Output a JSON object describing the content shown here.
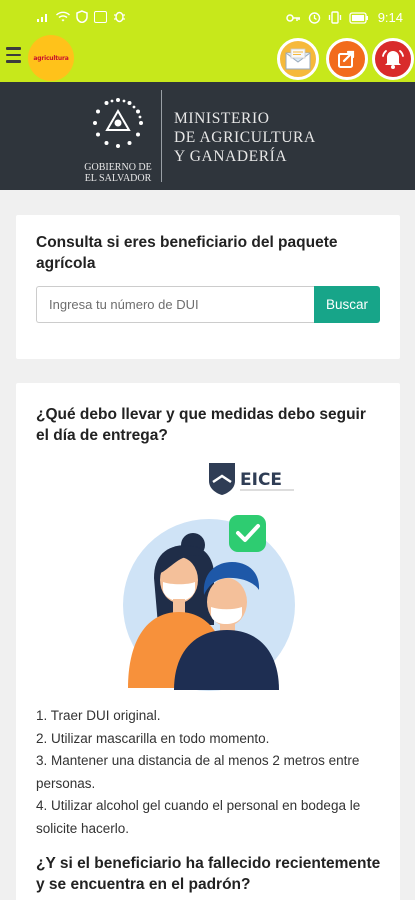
{
  "status_bar": {
    "time": "9:14",
    "left_icons": [
      "signal-icon",
      "wifi-icon",
      "shield-icon",
      "photo-icon",
      "bug-icon"
    ],
    "right_icons": [
      "key-icon",
      "alarm-icon",
      "vibrate-icon",
      "battery-icon"
    ]
  },
  "app_bar": {
    "logo_text": "agricultura",
    "actions": [
      "mail-icon",
      "share-icon",
      "alert-icon"
    ]
  },
  "header": {
    "gov_line1": "GOBIERNO DE",
    "gov_line2": "EL SALVADOR",
    "ministry_line1": "MINISTERIO",
    "ministry_line2": "DE AGRICULTURA",
    "ministry_line3": "Y GANADERÍA"
  },
  "consulta": {
    "title": "Consulta si eres beneficiario del paquete agrícola",
    "placeholder": "Ingresa tu número de DUI",
    "button": "Buscar"
  },
  "info": {
    "title": "¿Qué debo llevar y que medidas debo seguir el día de entrega?",
    "eice": "EICE",
    "steps": [
      "1. Traer DUI original.",
      "2. Utilizar mascarilla en todo momento.",
      "3. Mantener una distancia de al menos 2 metros entre personas.",
      "4. Utilizar alcohol gel cuando el personal en bodega le solicite hacerlo."
    ],
    "question2": "¿Y si el beneficiario ha fallecido recientemente y se encuentra en el padrón?"
  },
  "colors": {
    "lime": "#c7e81b",
    "header": "#2f353c",
    "button": "#17a589"
  }
}
